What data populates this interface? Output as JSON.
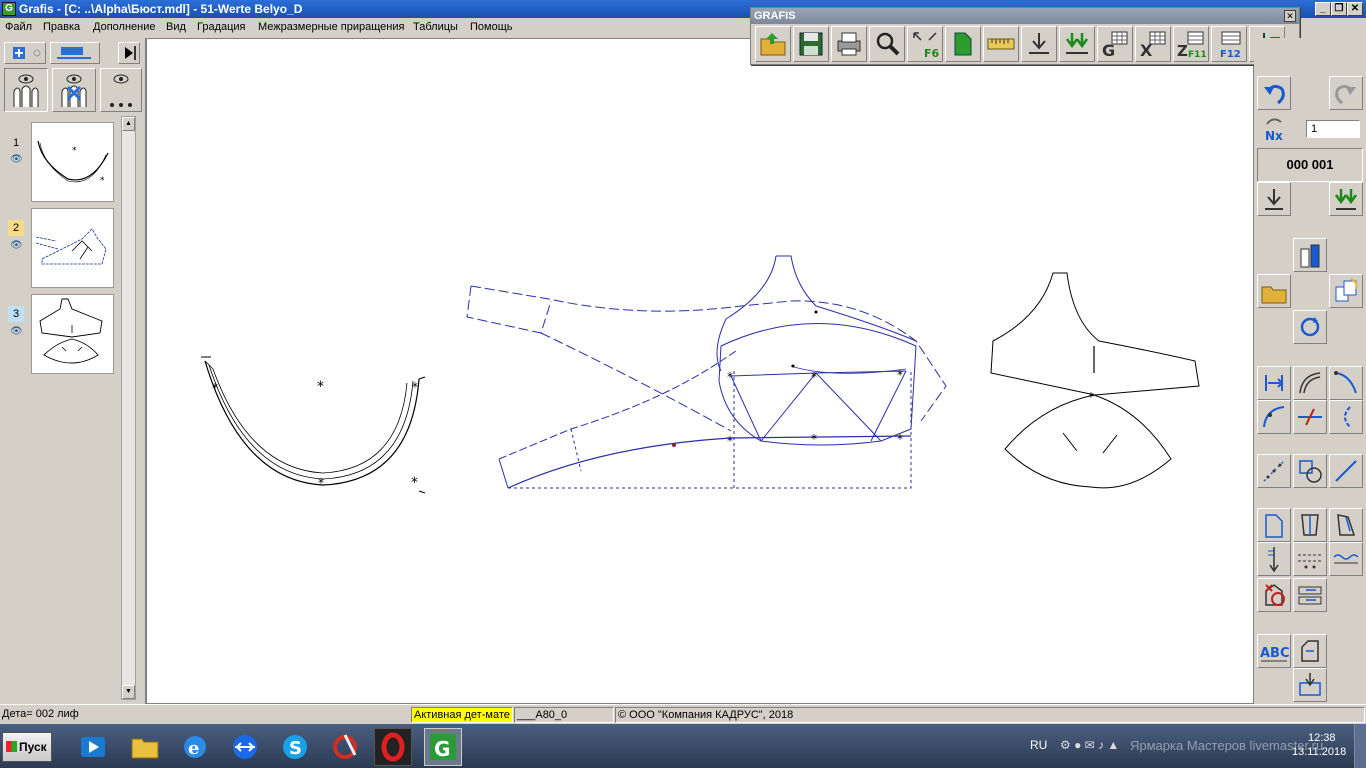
{
  "window": {
    "title": "Grafis - [C: ..\\Alpha\\Бюст.mdl] - 51-Werte Belyo_D",
    "app_icon": "G",
    "controls": {
      "minimize": "_",
      "restore": "❐",
      "close": "✕"
    }
  },
  "menu": [
    "Файл",
    "Правка",
    "Дополнение",
    "Вид",
    "Градация",
    "Межразмерные приращения",
    "Таблицы",
    "Помощь"
  ],
  "grafis_toolbar": {
    "title": "GRAFIS",
    "close": "✕",
    "buttons": [
      "open-folder-icon",
      "save-icon",
      "print-icon",
      "zoom-icon",
      "fit-view-icon",
      "piece-icon",
      "measure-icon",
      "insert-down-icon",
      "insert-all-down-icon",
      "g-table-icon",
      "x-table-icon",
      "z-table-icon",
      "f12-table-icon",
      "delete-down-icon"
    ],
    "labels": {
      "g": "G",
      "x": "X",
      "z": "Z",
      "f6": "F6",
      "f11": "F11",
      "f12": "F12"
    }
  },
  "left_panel": {
    "pieces": [
      {
        "number": "1",
        "highlight": ""
      },
      {
        "number": "2",
        "highlight": "#f7d98a"
      },
      {
        "number": "3",
        "highlight": "#bfe0f5"
      }
    ]
  },
  "right_panel": {
    "nx_label": "Nx",
    "nx_value": "1",
    "counter": "000 001",
    "abc_label": "ABC"
  },
  "status": {
    "detail": "Дета= 002  лиф",
    "active": "Активная дет-мате",
    "active_color": "#ffff00",
    "size": "___A80_0",
    "copyright": "© ООО \"Компания КАДРУС\", 2018"
  },
  "taskbar": {
    "start": "Пуск",
    "lang": "RU",
    "time": "12:38",
    "date": "13.11.2018"
  },
  "watermark": "Ярмарка Мастеров livemaster.ru"
}
